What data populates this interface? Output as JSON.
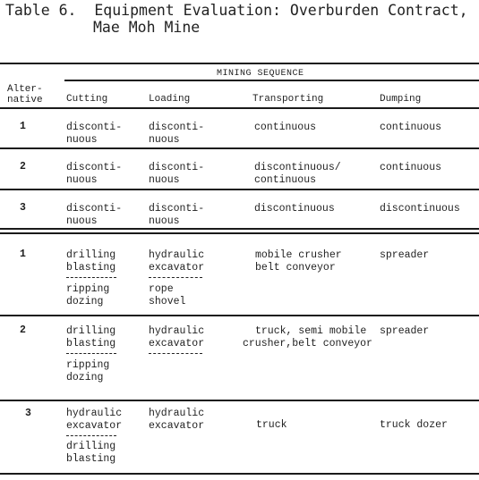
{
  "title": {
    "line1": "Table 6.  Equipment Evaluation: Overburden Contract,",
    "line2": "Mae Moh Mine"
  },
  "header": {
    "group": "MINING SEQUENCE",
    "alt1": "Alter-",
    "alt2": "native",
    "cols": [
      "Cutting",
      "Loading",
      "Transporting",
      "Dumping"
    ]
  },
  "section1": [
    {
      "alt": "1",
      "cutting": [
        "disconti-",
        "nuous"
      ],
      "loading": [
        "disconti-",
        "nuous"
      ],
      "transporting": [
        "continuous"
      ],
      "dumping": [
        "continuous"
      ]
    },
    {
      "alt": "2",
      "cutting": [
        "disconti-",
        "nuous"
      ],
      "loading": [
        "disconti-",
        "nuous"
      ],
      "transporting": [
        "discontinuous/",
        "continuous"
      ],
      "dumping": [
        "continuous"
      ]
    },
    {
      "alt": "3",
      "cutting": [
        "disconti-",
        "nuous"
      ],
      "loading": [
        "disconti-",
        "nuous"
      ],
      "transporting": [
        "discontinuous"
      ],
      "dumping": [
        "discontinuous"
      ]
    }
  ],
  "section2": [
    {
      "alt": "1",
      "cutting": {
        "a": [
          "drilling",
          "blasting"
        ],
        "b": [
          "ripping",
          "dozing"
        ]
      },
      "loading": {
        "a": [
          "hydraulic",
          "excavator"
        ],
        "b": [
          "rope",
          "shovel"
        ]
      },
      "transporting": [
        "mobile crusher",
        "belt conveyor"
      ],
      "dumping": [
        "spreader"
      ]
    },
    {
      "alt": "2",
      "cutting": {
        "a": [
          "drilling",
          "blasting"
        ],
        "b": [
          "ripping",
          "dozing"
        ]
      },
      "loading": {
        "a": [
          "hydraulic",
          "excavator"
        ],
        "b": []
      },
      "transporting": [
        "truck, semi mobile",
        "crusher,belt conveyor"
      ],
      "dumping": [
        "spreader"
      ]
    },
    {
      "alt": "3",
      "cutting": {
        "a": [
          "hydraulic",
          "excavator"
        ],
        "b": [
          "drilling",
          "blasting"
        ]
      },
      "loading": {
        "a": [
          "hydraulic",
          "excavator"
        ],
        "b": []
      },
      "transporting": [
        "truck"
      ],
      "dumping": [
        "truck dozer"
      ]
    }
  ]
}
